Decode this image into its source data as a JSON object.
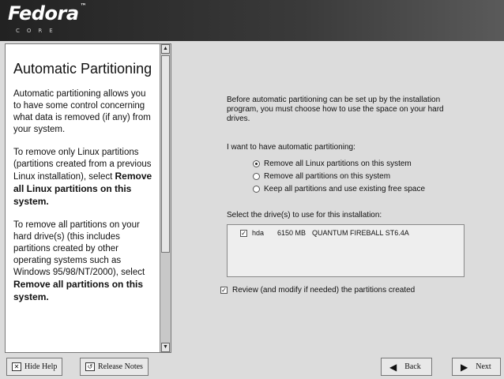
{
  "header": {
    "brand": "Fedora",
    "tm": "™",
    "sub": "CORE"
  },
  "help": {
    "title": "Automatic Partitioning",
    "p1": "Automatic partitioning allows you to have some control concerning what data is removed (if any) from your system.",
    "p2_text": "To remove only Linux partitions (partitions created from a previous Linux installation), select",
    "p2_bold": "Remove all Linux partitions on this system.",
    "p3_text": "To remove all partitions on your hard drive(s) (this includes partitions created by other operating systems such as Windows 95/98/NT/2000), select",
    "p3_bold": "Remove all partitions on this system."
  },
  "main": {
    "intro": "Before automatic partitioning can be set up by the installation program, you must choose how to use the space on your hard drives.",
    "question": "I want to have automatic partitioning:",
    "options": [
      {
        "label": "Remove all Linux partitions on this system",
        "selected": true
      },
      {
        "label": "Remove all partitions on this system",
        "selected": false
      },
      {
        "label": "Keep all partitions and use existing free space",
        "selected": false
      }
    ],
    "drives_label": "Select the drive(s) to use for this installation:",
    "drives": [
      {
        "checked": true,
        "name": "hda",
        "size": "6150 MB",
        "model": "QUANTUM FIREBALL ST6.4A"
      }
    ],
    "review_label": "Review (and modify if needed) the partitions created",
    "review_checked": true
  },
  "buttons": {
    "hide_help": "Hide Help",
    "release_notes": "Release Notes",
    "back": "Back",
    "next": "Next"
  }
}
